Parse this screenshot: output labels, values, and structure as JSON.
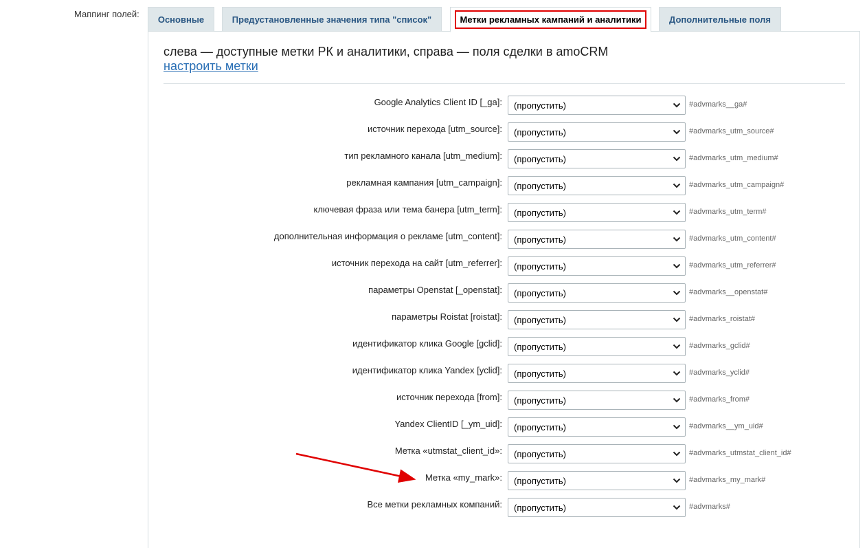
{
  "mapping_label": "Маппинг полей:",
  "tabs": [
    {
      "label": "Основные"
    },
    {
      "label": "Предустановленные значения типа \"список\""
    },
    {
      "label": "Метки рекламных кампаний и аналитики"
    },
    {
      "label": "Дополнительные поля"
    }
  ],
  "active_tab_index": 2,
  "panel": {
    "description": "слева — доступные метки РК и аналитики, справа — поля сделки в amoCRM",
    "configure_link": "настроить метки"
  },
  "rows": [
    {
      "label": "Google Analytics Client ID [_ga]:",
      "value": "(пропустить)",
      "code": "#advmarks__ga#"
    },
    {
      "label": "источник перехода [utm_source]:",
      "value": "(пропустить)",
      "code": "#advmarks_utm_source#"
    },
    {
      "label": "тип рекламного канала [utm_medium]:",
      "value": "(пропустить)",
      "code": "#advmarks_utm_medium#"
    },
    {
      "label": "рекламная кампания [utm_campaign]:",
      "value": "(пропустить)",
      "code": "#advmarks_utm_campaign#"
    },
    {
      "label": "ключевая фраза или тема банера [utm_term]:",
      "value": "(пропустить)",
      "code": "#advmarks_utm_term#"
    },
    {
      "label": "дополнительная информация о рекламе [utm_content]:",
      "value": "(пропустить)",
      "code": "#advmarks_utm_content#"
    },
    {
      "label": "источник перехода на сайт [utm_referrer]:",
      "value": "(пропустить)",
      "code": "#advmarks_utm_referrer#"
    },
    {
      "label": "параметры Openstat [_openstat]:",
      "value": "(пропустить)",
      "code": "#advmarks__openstat#"
    },
    {
      "label": "параметры Roistat [roistat]:",
      "value": "(пропустить)",
      "code": "#advmarks_roistat#"
    },
    {
      "label": "идентификатор клика Google [gclid]:",
      "value": "(пропустить)",
      "code": "#advmarks_gclid#"
    },
    {
      "label": "идентификатор клика Yandex [yclid]:",
      "value": "(пропустить)",
      "code": "#advmarks_yclid#"
    },
    {
      "label": "источник перехода [from]:",
      "value": "(пропустить)",
      "code": "#advmarks_from#"
    },
    {
      "label": "Yandex ClientID [_ym_uid]:",
      "value": "(пропустить)",
      "code": "#advmarks__ym_uid#"
    },
    {
      "label": "Метка «utmstat_client_id»:",
      "value": "(пропустить)",
      "code": "#advmarks_utmstat_client_id#"
    },
    {
      "label": "Метка «my_mark»:",
      "value": "(пропустить)",
      "code": "#advmarks_my_mark#"
    },
    {
      "label": "Все метки рекламных компаний:",
      "value": "(пропустить)",
      "code": "#advmarks#"
    }
  ],
  "colors": {
    "highlight": "#e00000",
    "tab_bg": "#dfe7ea",
    "tab_text": "#2a5783",
    "link": "#2a6fb5"
  }
}
